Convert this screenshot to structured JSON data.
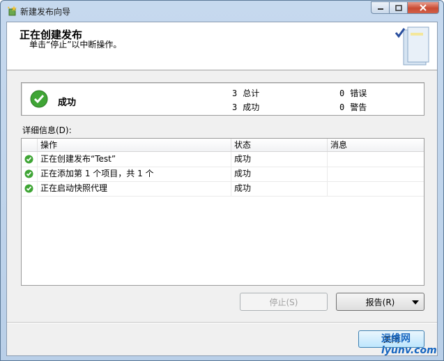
{
  "window": {
    "title": "新建发布向导"
  },
  "header": {
    "title": "正在创建发布",
    "subtitle": "单击“停止”以中断操作。"
  },
  "status": {
    "text": "成功",
    "total_count": "3",
    "total_label": "总计",
    "success_count": "3",
    "success_label": "成功",
    "error_count": "0",
    "error_label": "错误",
    "warning_count": "0",
    "warning_label": "警告"
  },
  "details_label": "详细信息(D):",
  "table": {
    "columns": [
      "操作",
      "状态",
      "消息"
    ],
    "rows": [
      {
        "action": "正在创建发布“Test”",
        "status": "成功",
        "message": ""
      },
      {
        "action": "正在添加第 1 个项目，共 1 个",
        "status": "成功",
        "message": ""
      },
      {
        "action": "正在启动快照代理",
        "status": "成功",
        "message": ""
      }
    ]
  },
  "buttons": {
    "stop": "停止(S)",
    "report": "报告(R)",
    "close": "关闭"
  },
  "watermark": {
    "line1": "运维网",
    "line2": "iyunv.com"
  },
  "colors": {
    "success_green": "#3fa535",
    "titlebar": "#c6d9ee",
    "close_button": "#c94b33"
  }
}
